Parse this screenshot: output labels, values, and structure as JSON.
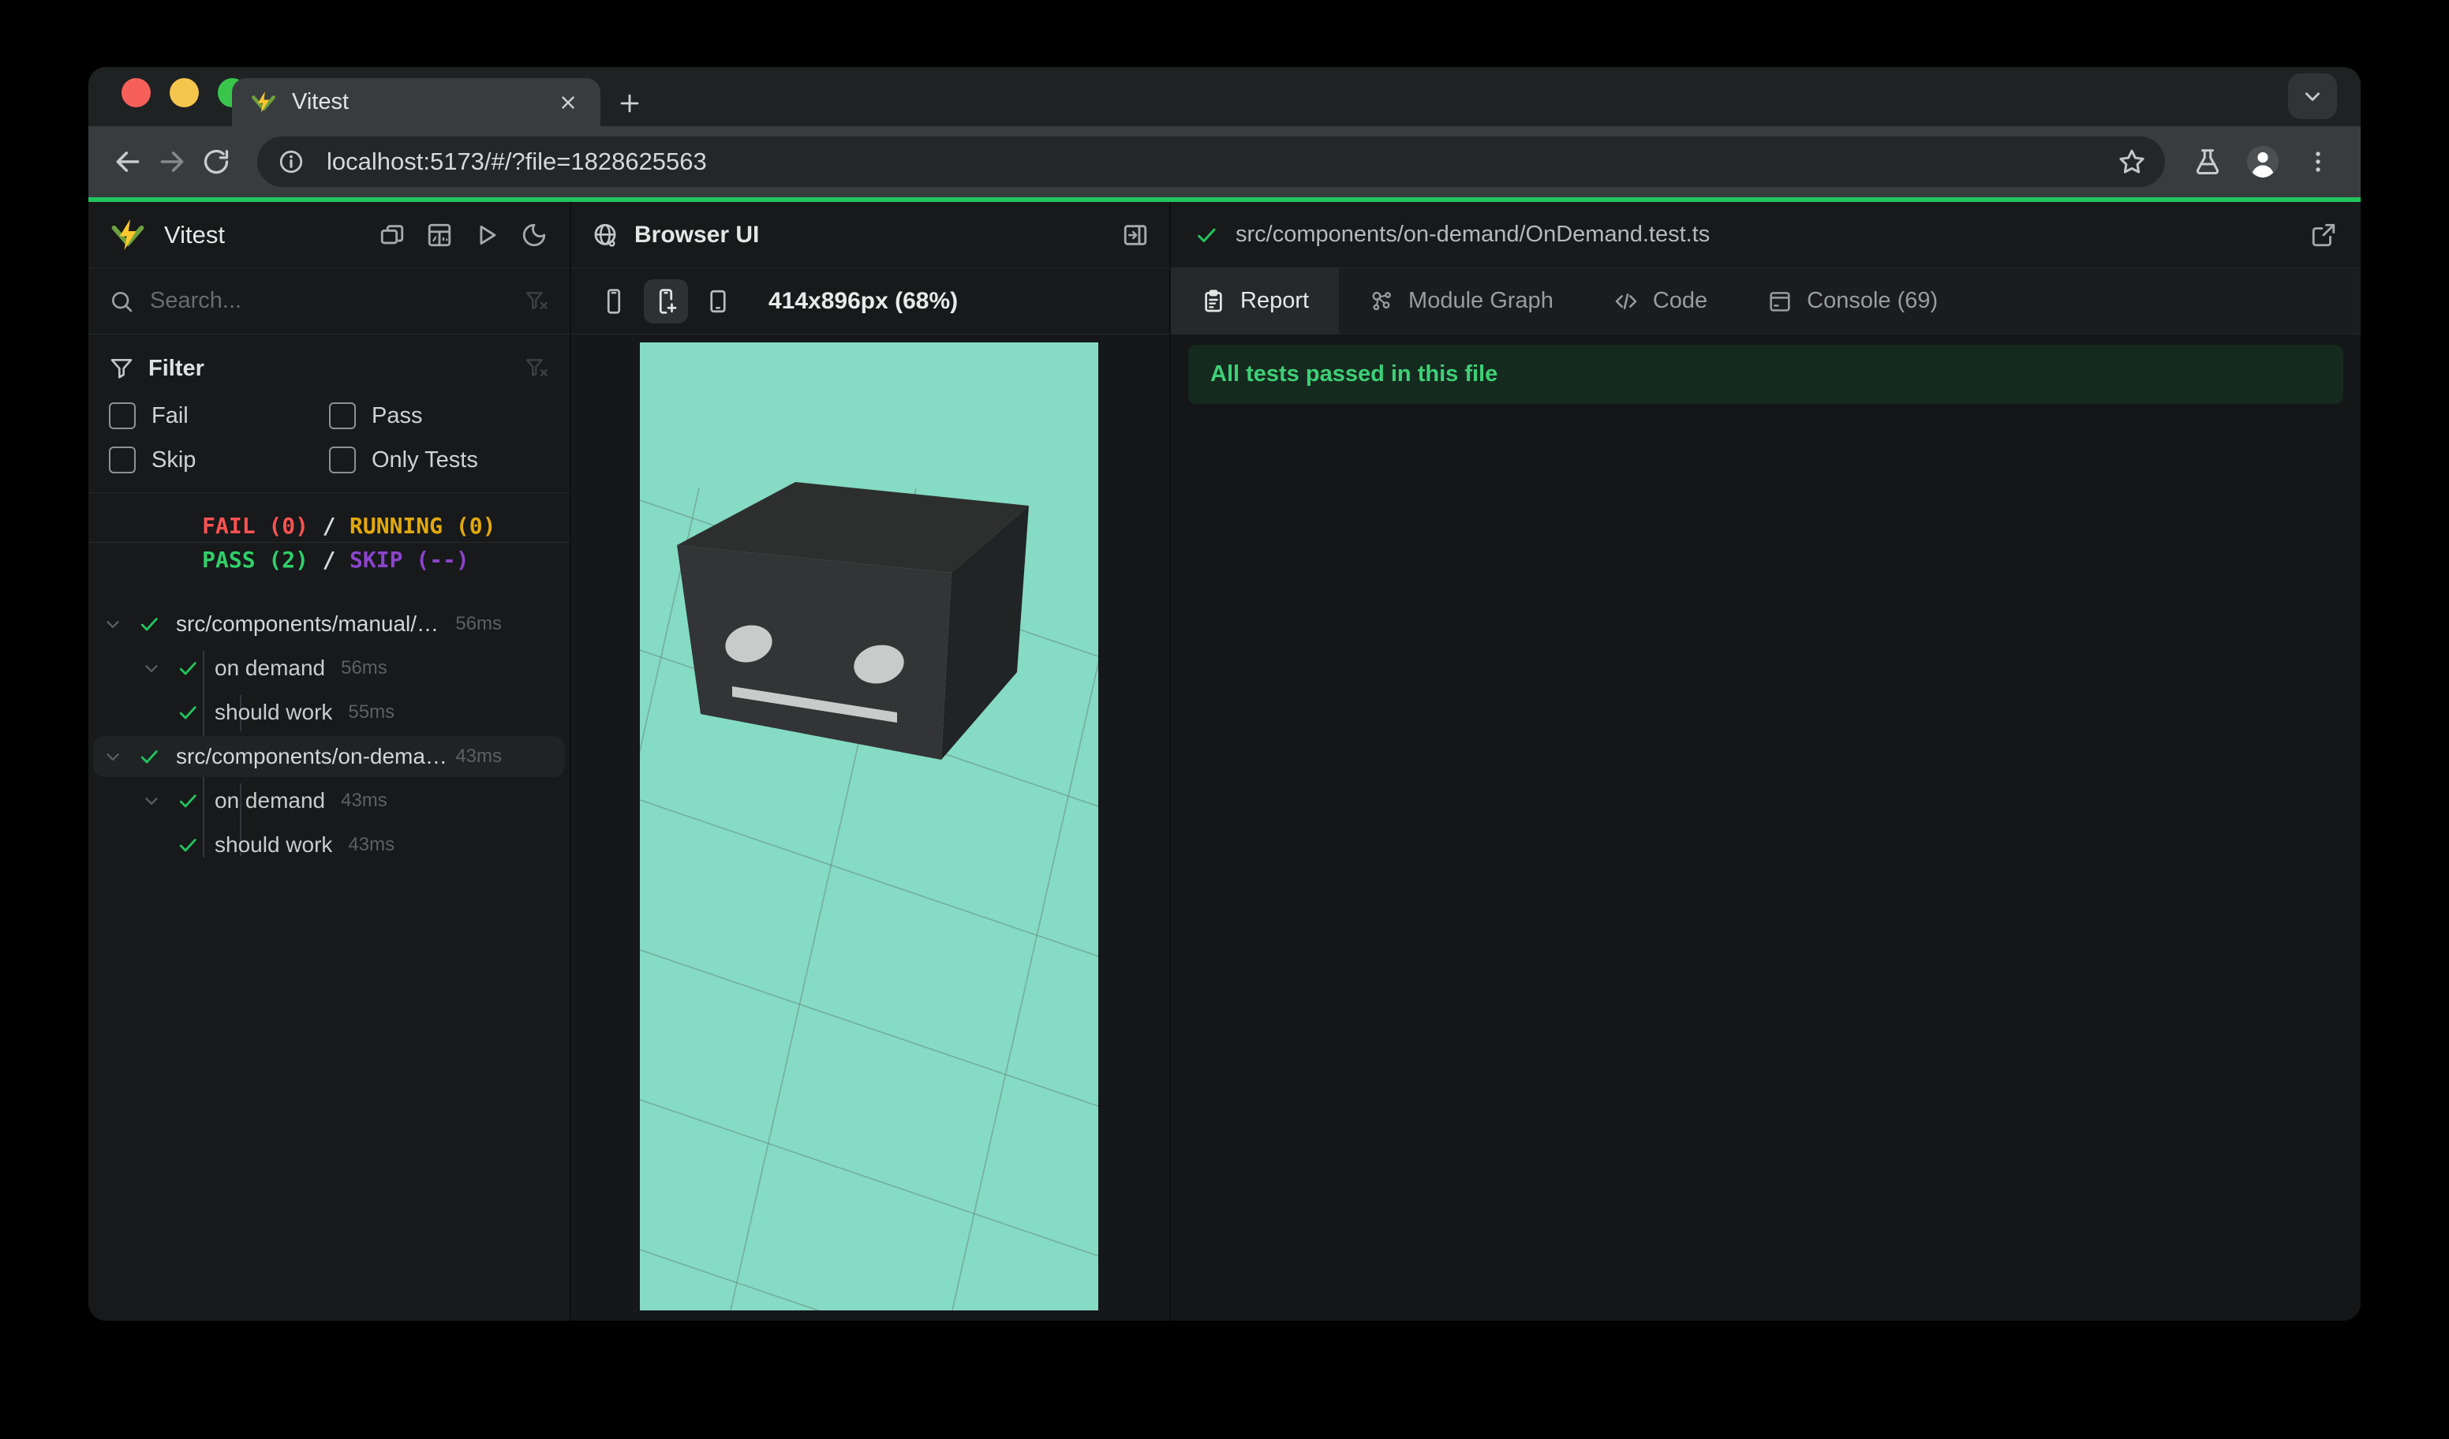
{
  "browser": {
    "tab_title": "Vitest",
    "url": "localhost:5173/#/?file=1828625563"
  },
  "sidebar": {
    "app_name": "Vitest",
    "search_placeholder": "Search...",
    "filter": {
      "title": "Filter",
      "options": [
        "Fail",
        "Pass",
        "Skip",
        "Only Tests"
      ]
    },
    "status": {
      "fail": "FAIL (0)",
      "running": "RUNNING (0)",
      "pass": "PASS (2)",
      "skip": "SKIP (--)",
      "separator": "/"
    },
    "tree": [
      {
        "label": "src/components/manual/…",
        "time": "56ms"
      },
      {
        "label": "on demand",
        "time": "56ms"
      },
      {
        "label": "should work",
        "time": "55ms"
      },
      {
        "label": "src/components/on-dema…",
        "time": "43ms"
      },
      {
        "label": "on demand",
        "time": "43ms"
      },
      {
        "label": "should work",
        "time": "43ms"
      }
    ]
  },
  "preview": {
    "title": "Browser UI",
    "viewport_size": "414x896px (68%)"
  },
  "report": {
    "file_path": "src/components/on-demand/OnDemand.test.ts",
    "tabs": [
      "Report",
      "Module Graph",
      "Code",
      "Console (69)"
    ],
    "active_tab": "Report",
    "banner": "All tests passed in this file"
  },
  "colors": {
    "progress_green": "#21c55f",
    "pass_green": "#31d06a",
    "fail_red": "#fa5252",
    "running_yellow": "#e2a90c",
    "skip_purple": "#8b44cc",
    "banner_bg": "#152a1e",
    "banner_text": "#3ed077",
    "viewport_teal": "#85dbc3",
    "logo_yellow": "#fcc72b",
    "logo_green": "#6da13f"
  }
}
